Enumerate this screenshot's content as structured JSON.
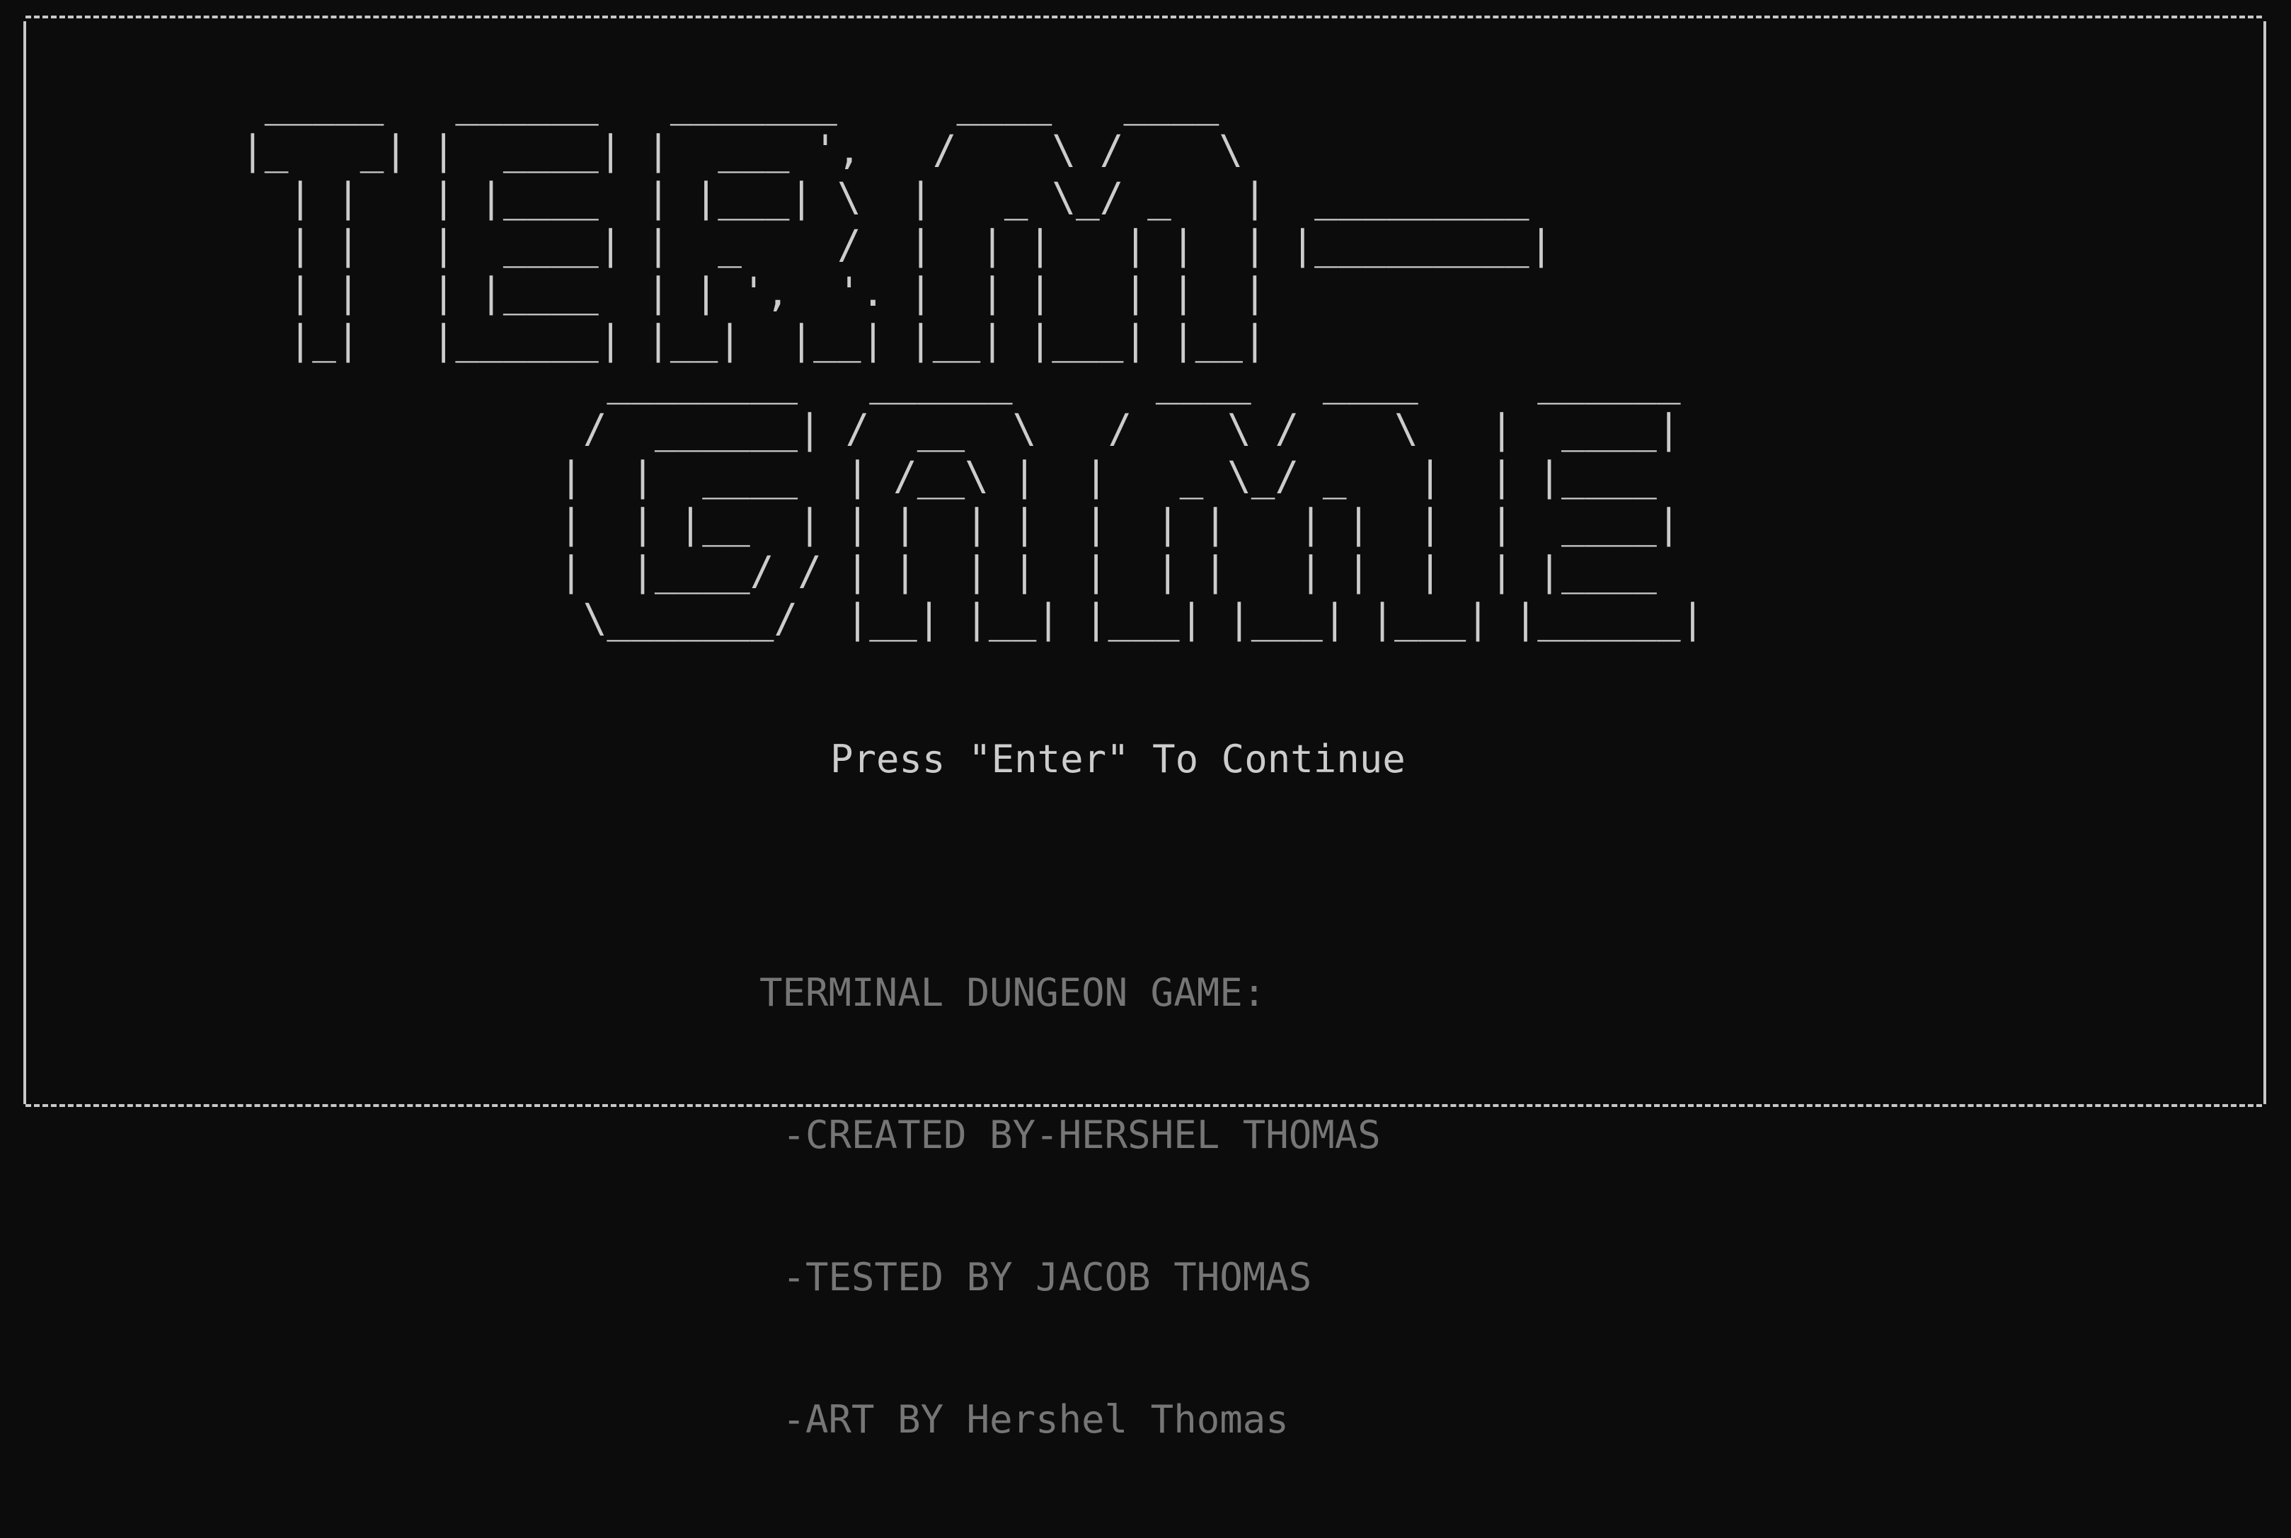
{
  "screen": {
    "title_art_line1": " _____   ______   _______     ____   ____\n|_   _| |  ____| |  ___ ',   /    \\ /    \\\n  | |   | |____  | |___| \\  |   _ \\_/ _   |  _________\n  | |   |  ____| |  _    /  |  | |   | |  | |_________|\n  | |   | |____  | | ',  '. |  | |   | |  |\n  |_|   |______| |__|  |__| |__| |___| |__|",
    "title_art_line2": "  ________   ______      ____   ____     ______\n /  ______| /  __  \\   /    \\ /    \\   |  ____|\n|  |  ____  | /__\\ |  |   _ \\_/ _   |  | |____\n|  | |__  | | |  | |  |  | |   | |  |  |  ____|\n|  |____/ / | |  | |  |  | |   | |  |  | |____\n \\_______/  |__| |__| |___| |___| |___| |______|",
    "prompt": "Press \"Enter\" To Continue",
    "credits": [
      "TERMINAL DUNGEON GAME:",
      " -CREATED BY-HERSHEL THOMAS",
      " -TESTED BY JACOB THOMAS",
      " -ART BY Hershel Thomas"
    ]
  },
  "colors": {
    "background": "#0c0c0c",
    "foreground": "#cccccc",
    "dim": "#767676",
    "frame": "#c8c8c8"
  }
}
